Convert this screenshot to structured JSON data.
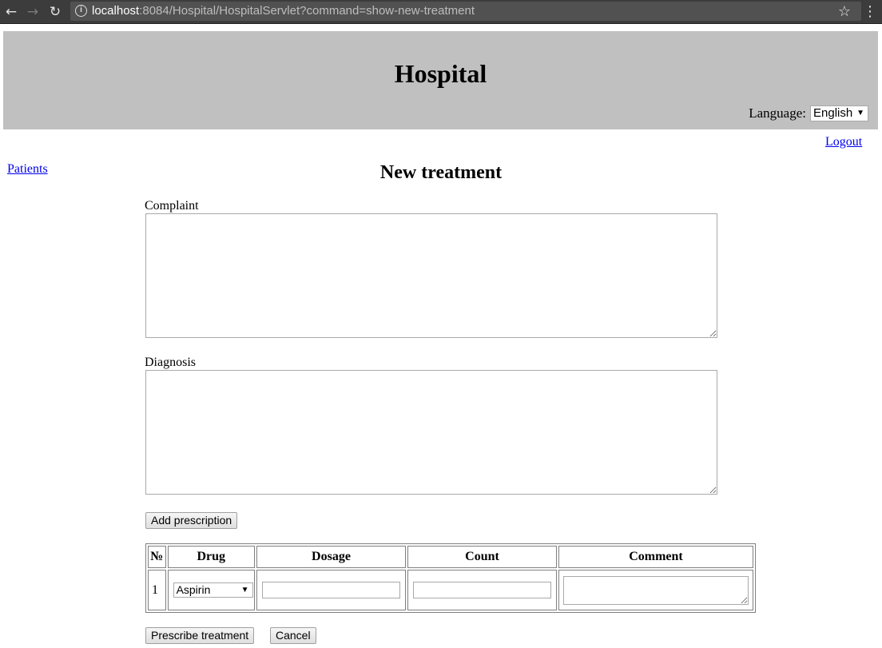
{
  "browser": {
    "url_host": "localhost",
    "url_rest": ":8084/Hospital/HospitalServlet?command=show-new-treatment",
    "back_glyph": "←",
    "forward_glyph": "→",
    "reload_glyph": "↻",
    "info_glyph": "i",
    "star_glyph": "☆",
    "menu_glyph": "⋮"
  },
  "header": {
    "title": "Hospital",
    "language_label": "Language:",
    "language_value": "English",
    "caret": "▼"
  },
  "nav": {
    "logout": "Logout",
    "patients": "Patients"
  },
  "form": {
    "title": "New treatment",
    "complaint_label": "Complaint",
    "complaint_value": "",
    "diagnosis_label": "Diagnosis",
    "diagnosis_value": "",
    "add_prescription": "Add prescription",
    "prescribe": "Prescribe treatment",
    "cancel": "Cancel"
  },
  "prescriptions": {
    "headers": [
      "№",
      "Drug",
      "Dosage",
      "Count",
      "Comment"
    ],
    "rows": [
      {
        "number": "1",
        "drug": "Aspirin",
        "dosage": "",
        "count": "",
        "comment": ""
      }
    ]
  },
  "colors": {
    "header_bg": "#c0c0c0",
    "link": "#0000ee",
    "chrome_bg": "#3c3c3c"
  }
}
